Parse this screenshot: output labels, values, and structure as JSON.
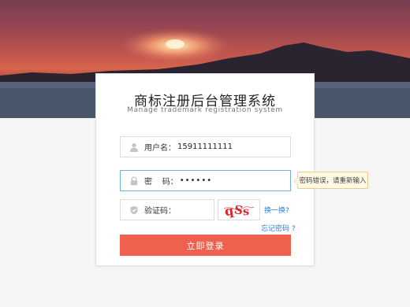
{
  "header": {
    "title": "商标注册后台管理系统",
    "subtitle": "Manage trademark registration system"
  },
  "form": {
    "username": {
      "label": "用户名：",
      "value": "15911111111",
      "icon": "user-icon"
    },
    "password": {
      "label": "密    码：",
      "value": "••••••",
      "icon": "lock-icon"
    },
    "captcha": {
      "label": "验证码：",
      "value": "",
      "icon": "shield-icon",
      "image_text": "qSs",
      "refresh_label": "换一换?"
    },
    "forgot_label": "忘记密码 ?",
    "submit_label": "立即登录"
  },
  "error_tooltip": {
    "text": "密码错误，请重新输入"
  },
  "colors": {
    "accent": "#f0604f",
    "link": "#2f7fd1",
    "focus_border": "#6fb1e6",
    "tooltip_bg": "#fff8e6",
    "tooltip_border": "#efc98a"
  }
}
